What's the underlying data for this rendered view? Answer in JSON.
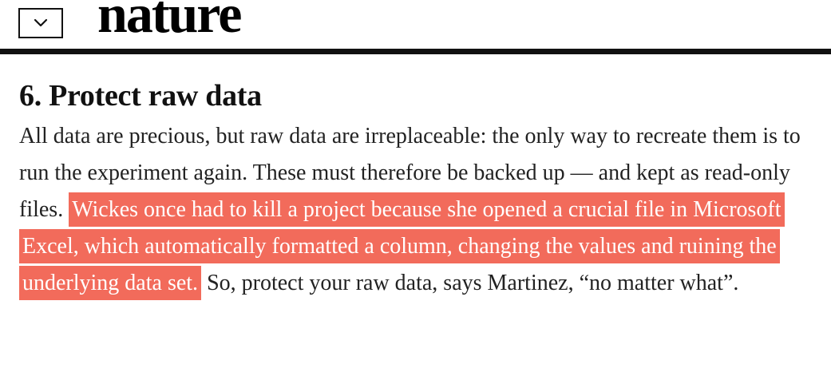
{
  "header": {
    "menu_icon": "chevron-down-icon",
    "logo_text": "nature"
  },
  "article": {
    "section_title": "6. Protect raw data",
    "paragraph": {
      "text_before": "All data are precious, but raw data are irreplaceable: the only way to recreate them is to run the experiment again. These must therefore be backed up — and kept as read-only files.",
      "highlighted_text": "Wickes once had to kill a project because she opened a crucial file in Microsoft Excel, which automatically formatted a column, changing the values and ruining the underlying data set.",
      "text_after": "So, protect your raw data, says Martinez, “no matter what”."
    }
  },
  "colors": {
    "highlight": "#f26b5b",
    "text": "#222222",
    "rule": "#111111"
  }
}
